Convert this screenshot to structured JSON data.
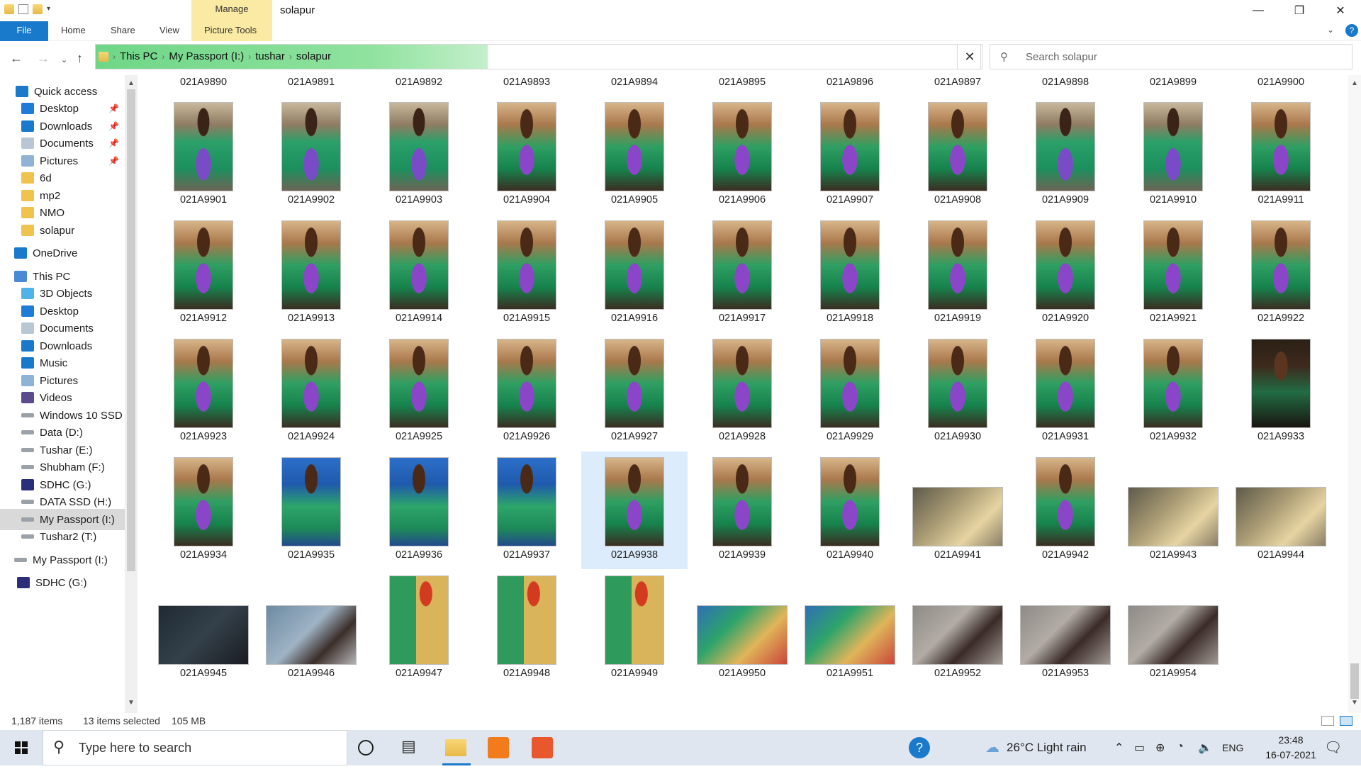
{
  "window": {
    "title": "solapur",
    "manage_tab": "Manage",
    "minimize": "—",
    "maximize": "❐",
    "close": "✕"
  },
  "ribbon": {
    "file": "File",
    "tabs": [
      "Home",
      "Share",
      "View",
      "Picture Tools"
    ]
  },
  "address": {
    "crumbs": [
      "This PC",
      "My Passport (I:)",
      "tushar",
      "solapur"
    ],
    "search_placeholder": "Search solapur"
  },
  "sidebar": {
    "items": [
      {
        "label": "Quick access",
        "icon": "star-icon",
        "pinned": false
      },
      {
        "label": "Desktop",
        "icon": "desktop-icon",
        "pinned": true
      },
      {
        "label": "Downloads",
        "icon": "download-icon",
        "pinned": true
      },
      {
        "label": "Documents",
        "icon": "documents-icon",
        "pinned": true
      },
      {
        "label": "Pictures",
        "icon": "pictures-icon",
        "pinned": true
      },
      {
        "label": "6d",
        "icon": "folder-icon",
        "pinned": false
      },
      {
        "label": "mp2",
        "icon": "folder-icon",
        "pinned": false
      },
      {
        "label": "NMO",
        "icon": "folder-icon",
        "pinned": false
      },
      {
        "label": "solapur",
        "icon": "folder-icon",
        "pinned": false
      },
      {
        "label": "OneDrive",
        "icon": "cloud-icon",
        "pinned": false
      },
      {
        "label": "This PC",
        "icon": "pc-icon",
        "pinned": false
      },
      {
        "label": "3D Objects",
        "icon": "cube-icon",
        "pinned": false
      },
      {
        "label": "Desktop",
        "icon": "desktop-icon",
        "pinned": false
      },
      {
        "label": "Documents",
        "icon": "documents-icon",
        "pinned": false
      },
      {
        "label": "Downloads",
        "icon": "download-icon",
        "pinned": false
      },
      {
        "label": "Music",
        "icon": "music-icon",
        "pinned": false
      },
      {
        "label": "Pictures",
        "icon": "pictures-icon",
        "pinned": false
      },
      {
        "label": "Videos",
        "icon": "videos-icon",
        "pinned": false
      },
      {
        "label": "Windows 10 SSD",
        "icon": "drive-icon",
        "pinned": false
      },
      {
        "label": "Data (D:)",
        "icon": "drive-icon",
        "pinned": false
      },
      {
        "label": "Tushar (E:)",
        "icon": "drive-icon",
        "pinned": false
      },
      {
        "label": "Shubham (F:)",
        "icon": "drive-icon",
        "pinned": false
      },
      {
        "label": "SDHC (G:)",
        "icon": "sdcard-icon",
        "pinned": false
      },
      {
        "label": "DATA SSD (H:)",
        "icon": "drive-icon",
        "pinned": false
      },
      {
        "label": "My Passport (I:)",
        "icon": "drive-icon",
        "pinned": false,
        "selected": true
      },
      {
        "label": "Tushar2 (T:)",
        "icon": "drive-icon",
        "pinned": false
      },
      {
        "label": "My Passport (I:)",
        "icon": "drive-icon",
        "pinned": false
      },
      {
        "label": "SDHC (G:)",
        "icon": "sdcard-icon",
        "pinned": false
      }
    ]
  },
  "files": {
    "top_row": [
      "021A9890",
      "021A9891",
      "021A9892",
      "021A9893",
      "021A9894",
      "021A9895",
      "021A9896",
      "021A9897",
      "021A9898",
      "021A9899",
      "021A9900"
    ],
    "rows": [
      [
        {
          "name": "021A9901",
          "o": "p",
          "c": "p-green"
        },
        {
          "name": "021A9902",
          "o": "p",
          "c": "p-green"
        },
        {
          "name": "021A9903",
          "o": "p",
          "c": "p-green"
        },
        {
          "name": "021A9904",
          "o": "p",
          "c": "p-warm"
        },
        {
          "name": "021A9905",
          "o": "p",
          "c": "p-warm"
        },
        {
          "name": "021A9906",
          "o": "p",
          "c": "p-warm"
        },
        {
          "name": "021A9907",
          "o": "p",
          "c": "p-warm"
        },
        {
          "name": "021A9908",
          "o": "p",
          "c": "p-warm"
        },
        {
          "name": "021A9909",
          "o": "p",
          "c": "p-green"
        },
        {
          "name": "021A9910",
          "o": "p",
          "c": "p-green"
        },
        {
          "name": "021A9911",
          "o": "p",
          "c": "p-warm"
        }
      ],
      [
        {
          "name": "021A9912",
          "o": "p",
          "c": "p-warm"
        },
        {
          "name": "021A9913",
          "o": "p",
          "c": "p-warm"
        },
        {
          "name": "021A9914",
          "o": "p",
          "c": "p-warm"
        },
        {
          "name": "021A9915",
          "o": "p",
          "c": "p-warm"
        },
        {
          "name": "021A9916",
          "o": "p",
          "c": "p-warm"
        },
        {
          "name": "021A9917",
          "o": "p",
          "c": "p-warm"
        },
        {
          "name": "021A9918",
          "o": "p",
          "c": "p-warm"
        },
        {
          "name": "021A9919",
          "o": "p",
          "c": "p-warm"
        },
        {
          "name": "021A9920",
          "o": "p",
          "c": "p-warm"
        },
        {
          "name": "021A9921",
          "o": "p",
          "c": "p-warm"
        },
        {
          "name": "021A9922",
          "o": "p",
          "c": "p-warm"
        }
      ],
      [
        {
          "name": "021A9923",
          "o": "p",
          "c": "p-warm"
        },
        {
          "name": "021A9924",
          "o": "p",
          "c": "p-warm"
        },
        {
          "name": "021A9925",
          "o": "p",
          "c": "p-warm"
        },
        {
          "name": "021A9926",
          "o": "p",
          "c": "p-warm"
        },
        {
          "name": "021A9927",
          "o": "p",
          "c": "p-warm"
        },
        {
          "name": "021A9928",
          "o": "p",
          "c": "p-warm"
        },
        {
          "name": "021A9929",
          "o": "p",
          "c": "p-warm"
        },
        {
          "name": "021A9930",
          "o": "p",
          "c": "p-warm"
        },
        {
          "name": "021A9931",
          "o": "p",
          "c": "p-warm"
        },
        {
          "name": "021A9932",
          "o": "p",
          "c": "p-warm"
        },
        {
          "name": "021A9933",
          "o": "p",
          "c": "p-dark"
        }
      ],
      [
        {
          "name": "021A9934",
          "o": "p",
          "c": "p-warm"
        },
        {
          "name": "021A9935",
          "o": "p",
          "c": "p-blue"
        },
        {
          "name": "021A9936",
          "o": "p",
          "c": "p-blue"
        },
        {
          "name": "021A9937",
          "o": "p",
          "c": "p-blue"
        },
        {
          "name": "021A9938",
          "o": "p",
          "c": "p-warm",
          "selected": true
        },
        {
          "name": "021A9939",
          "o": "p",
          "c": "p-warm"
        },
        {
          "name": "021A9940",
          "o": "p",
          "c": "p-warm"
        },
        {
          "name": "021A9941",
          "o": "l",
          "c": "l-gold"
        },
        {
          "name": "021A9942",
          "o": "p",
          "c": "p-warm"
        },
        {
          "name": "021A9943",
          "o": "l",
          "c": "l-gold"
        },
        {
          "name": "021A9944",
          "o": "l",
          "c": "l-gold"
        }
      ],
      [
        {
          "name": "021A9945",
          "o": "l",
          "c": "l-dark"
        },
        {
          "name": "021A9946",
          "o": "l",
          "c": "l-grey"
        },
        {
          "name": "021A9947",
          "o": "p",
          "c": "p-couple"
        },
        {
          "name": "021A9948",
          "o": "p",
          "c": "p-couple"
        },
        {
          "name": "021A9949",
          "o": "p",
          "c": "p-couple"
        },
        {
          "name": "021A9950",
          "o": "l",
          "c": "l-couple"
        },
        {
          "name": "021A9951",
          "o": "l",
          "c": "l-couple"
        },
        {
          "name": "021A9952",
          "o": "l",
          "c": "l-floor"
        },
        {
          "name": "021A9953",
          "o": "l",
          "c": "l-floor"
        },
        {
          "name": "021A9954",
          "o": "l",
          "c": "l-floor"
        }
      ]
    ]
  },
  "status": {
    "item_count": "1,187 items",
    "selected": "13 items selected",
    "size": "105 MB"
  },
  "taskbar": {
    "search_placeholder": "Type here to search",
    "weather": "26°C  Light rain",
    "language": "ENG",
    "time": "23:48",
    "date": "16-07-2021"
  },
  "colors": {
    "accent": "#1979ca",
    "selection": "#dcecfc",
    "manage_tab": "#fbeaa3",
    "address_fill": "#7fdc92"
  }
}
